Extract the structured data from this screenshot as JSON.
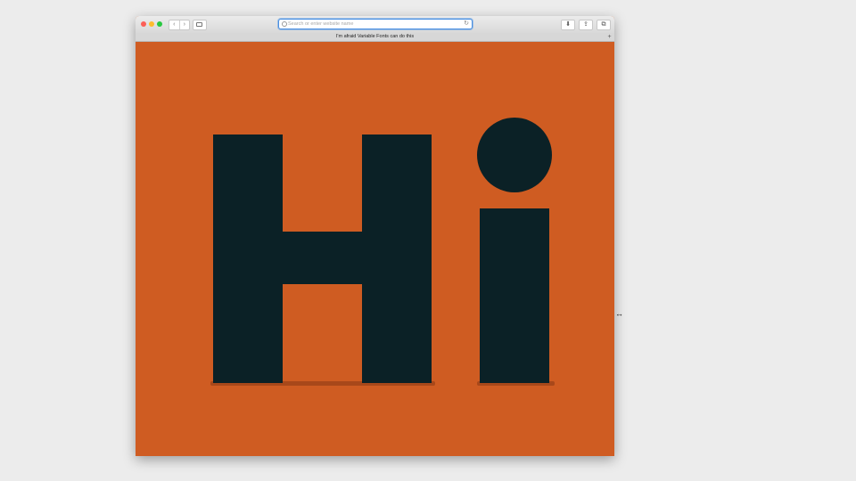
{
  "browser": {
    "nav_back": "‹",
    "nav_forward": "›",
    "address_placeholder": "Search or enter website name",
    "reload_icon": "↻",
    "tab_title": "I'm afraid Variable Fonts can do this",
    "new_tab_label": "+",
    "download_icon": "⬇",
    "share_icon": "⇪",
    "tabs_icon": "⧉"
  },
  "page": {
    "background_color": "#cf5c22",
    "glyph_color": "#0b2126",
    "letter_h": "H",
    "letter_i": "i"
  }
}
